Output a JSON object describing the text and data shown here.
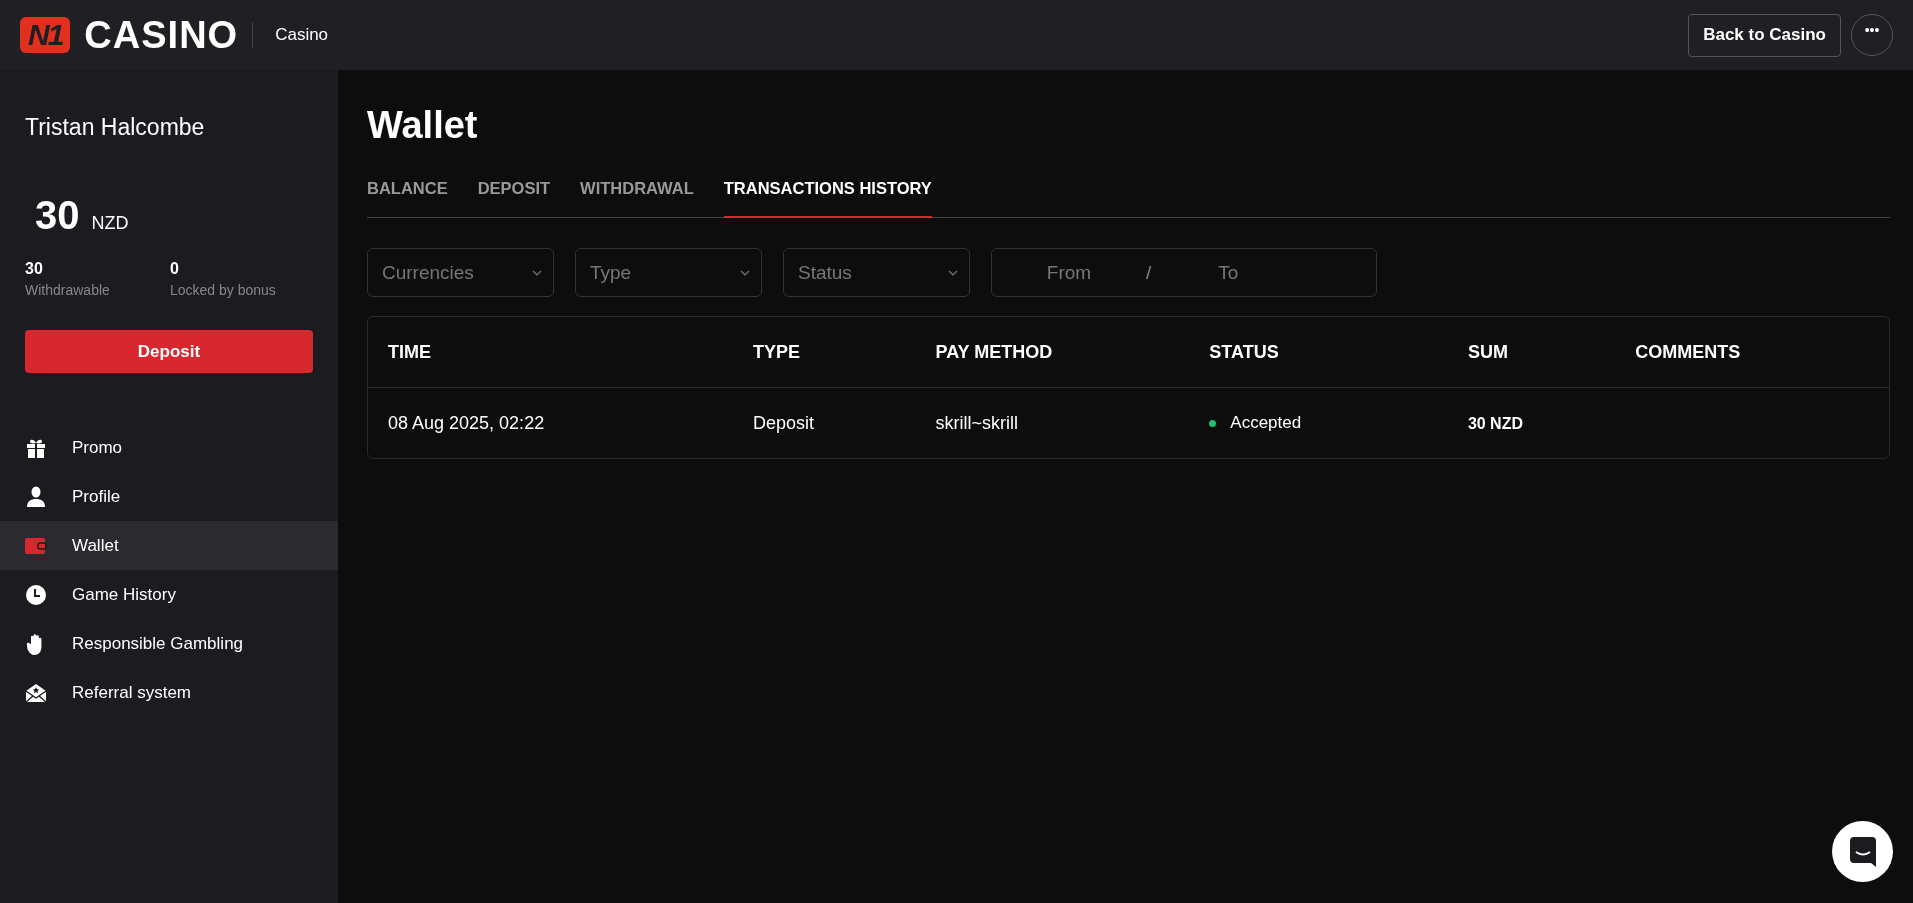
{
  "header": {
    "logo": {
      "mark": "N1",
      "wordmark": "CASINO"
    },
    "section": "Casino",
    "back_button": "Back to Casino",
    "more_button": "•••"
  },
  "sidebar": {
    "user_name": "Tristan Halcombe",
    "balance": {
      "amount": "30",
      "currency": "NZD"
    },
    "stats": [
      {
        "value": "30",
        "label": "Withdrawable"
      },
      {
        "value": "0",
        "label": "Locked by bonus"
      }
    ],
    "deposit_button": "Deposit",
    "items": [
      {
        "label": "Promo",
        "kind": "gift",
        "selected": false
      },
      {
        "label": "Profile",
        "kind": "person",
        "selected": false
      },
      {
        "label": "Wallet",
        "kind": "wallet",
        "selected": true
      },
      {
        "label": "Game History",
        "kind": "clock",
        "selected": false
      },
      {
        "label": "Responsible Gambling",
        "kind": "hand",
        "selected": false
      },
      {
        "label": "Referral system",
        "kind": "envelope",
        "selected": false
      }
    ]
  },
  "main": {
    "title": "Wallet",
    "tabs": [
      {
        "label": "BALANCE",
        "selected": false
      },
      {
        "label": "DEPOSIT",
        "selected": false
      },
      {
        "label": "WITHDRAWAL",
        "selected": false
      },
      {
        "label": "TRANSACTIONS HISTORY",
        "selected": true
      }
    ],
    "filters": [
      {
        "placeholder": "Currencies"
      },
      {
        "placeholder": "Type"
      },
      {
        "placeholder": "Status"
      }
    ],
    "date_range": {
      "from_placeholder": "From",
      "separator": "/",
      "to_placeholder": "To"
    },
    "table": {
      "columns": [
        "TIME",
        "TYPE",
        "PAY METHOD",
        "STATUS",
        "SUM",
        "COMMENTS"
      ],
      "rows": [
        {
          "time": "08 Aug 2025, 02:22",
          "type": "Deposit",
          "pay_method": "skrill~skrill",
          "status": "Accepted",
          "color": "#1fbf75",
          "sum": "30 NZD"
        }
      ]
    }
  }
}
